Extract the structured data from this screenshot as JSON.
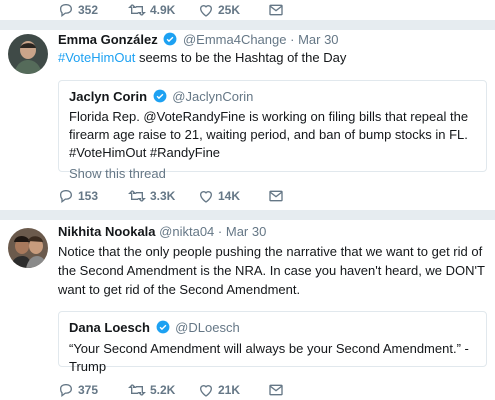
{
  "top_actions": {
    "replies": "352",
    "retweets": "4.9K",
    "likes": "25K"
  },
  "tweet1": {
    "name": "Emma González",
    "handle": "@Emma4Change",
    "separator": "·",
    "date": "Mar 30",
    "hashtag": "#VoteHimOut",
    "text_rest": " seems to be the Hashtag of the Day",
    "quote": {
      "name": "Jaclyn Corin",
      "handle": "@JaclynCorin",
      "text": "Florida Rep. @VoteRandyFine is working on filing bills that repeal the firearm age raise to 21, waiting period, and ban of bump stocks in FL. #VoteHimOut #RandyFine",
      "show_thread": "Show this thread"
    },
    "actions": {
      "replies": "153",
      "retweets": "3.3K",
      "likes": "14K"
    }
  },
  "tweet2": {
    "name": "Nikhita Nookala",
    "handle": "@nikta04",
    "separator": "·",
    "date": "Mar 30",
    "text": "Notice that the only people pushing the narrative that we want to get rid of the Second Amendment is the NRA. In case you haven't heard, we DON'T want to get rid of the Second Amendment.",
    "quote": {
      "name": "Dana Loesch",
      "handle": "@DLoesch",
      "text": "“Your Second Amendment will always be your Second Amendment.” - Trump"
    },
    "actions": {
      "replies": "375",
      "retweets": "5.2K",
      "likes": "21K"
    }
  },
  "colors": {
    "accent": "#1da1f2",
    "muted": "#657786",
    "border": "#e1e8ed",
    "separator": "#e6ecf0"
  }
}
